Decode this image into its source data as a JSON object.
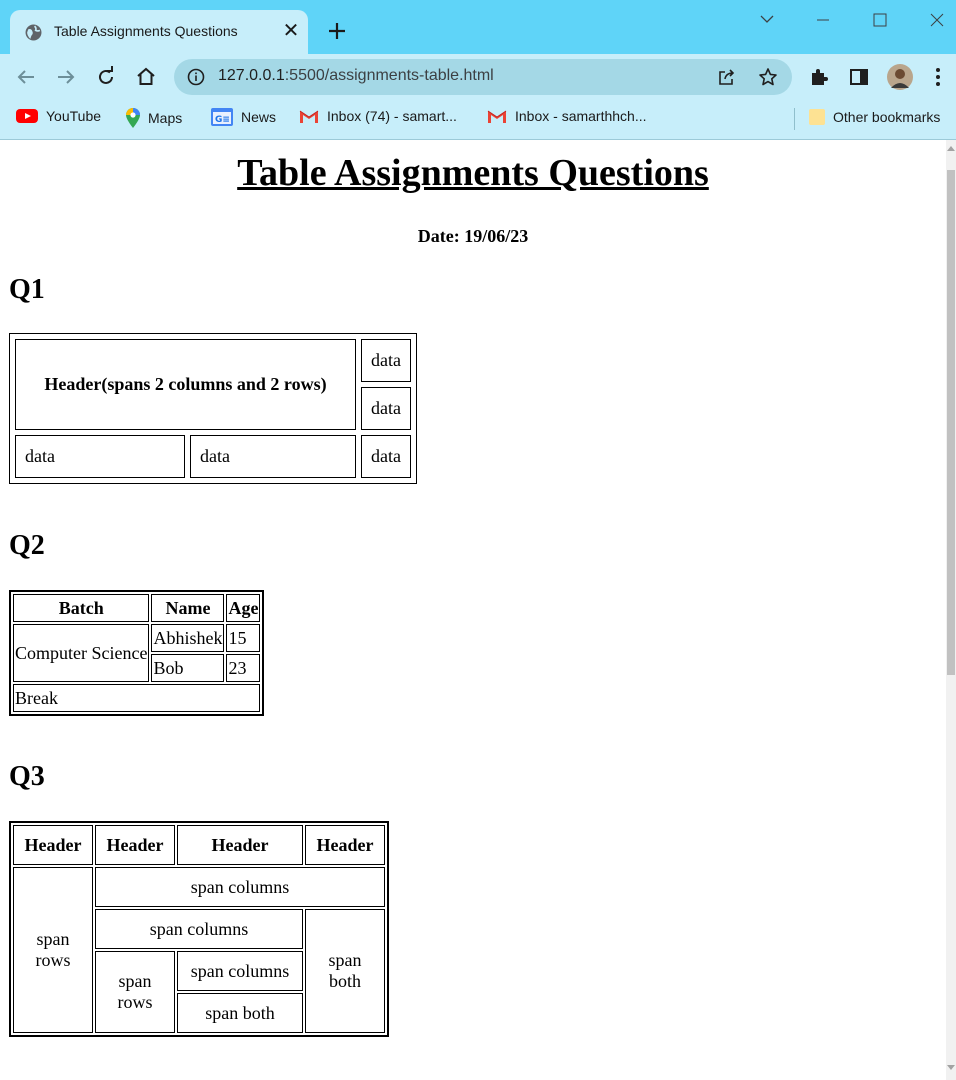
{
  "browser": {
    "tab_title": "Table Assignments Questions",
    "url_host": "127.0.0.1",
    "url_rest": ":5500/assignments-table.html",
    "bookmarks": [
      {
        "label": "YouTube",
        "icon": "youtube-icon"
      },
      {
        "label": "Maps",
        "icon": "maps-icon"
      },
      {
        "label": "News",
        "icon": "news-icon"
      },
      {
        "label": "Inbox (74) - samart...",
        "icon": "gmail-icon"
      },
      {
        "label": "Inbox - samarthhch...",
        "icon": "gmail-icon"
      }
    ],
    "other_bookmarks": "Other bookmarks"
  },
  "page": {
    "title": "Table Assignments Questions",
    "date": "Date: 19/06/23",
    "q1": {
      "heading": "Q1",
      "header": "Header(spans 2 columns and 2 rows)",
      "r1c3": "data",
      "r2c3": "data",
      "r3c1": "data",
      "r3c2": "data",
      "r3c3": "data"
    },
    "q2": {
      "heading": "Q2",
      "headers": [
        "Batch",
        "Name",
        "Age"
      ],
      "batch": "Computer Science",
      "rows": [
        {
          "name": "Abhishek",
          "age": "15"
        },
        {
          "name": "Bob",
          "age": "23"
        }
      ],
      "footer": "Break"
    },
    "q3": {
      "heading": "Q3",
      "headers": [
        "Header",
        "Header",
        "Header",
        "Header"
      ],
      "span_rows_1": "span rows",
      "span_columns_1": "span columns",
      "span_columns_2": "span columns",
      "span_both_1": "span both",
      "span_rows_2": "span rows",
      "span_columns_3": "span columns",
      "span_both_2": "span both"
    }
  }
}
